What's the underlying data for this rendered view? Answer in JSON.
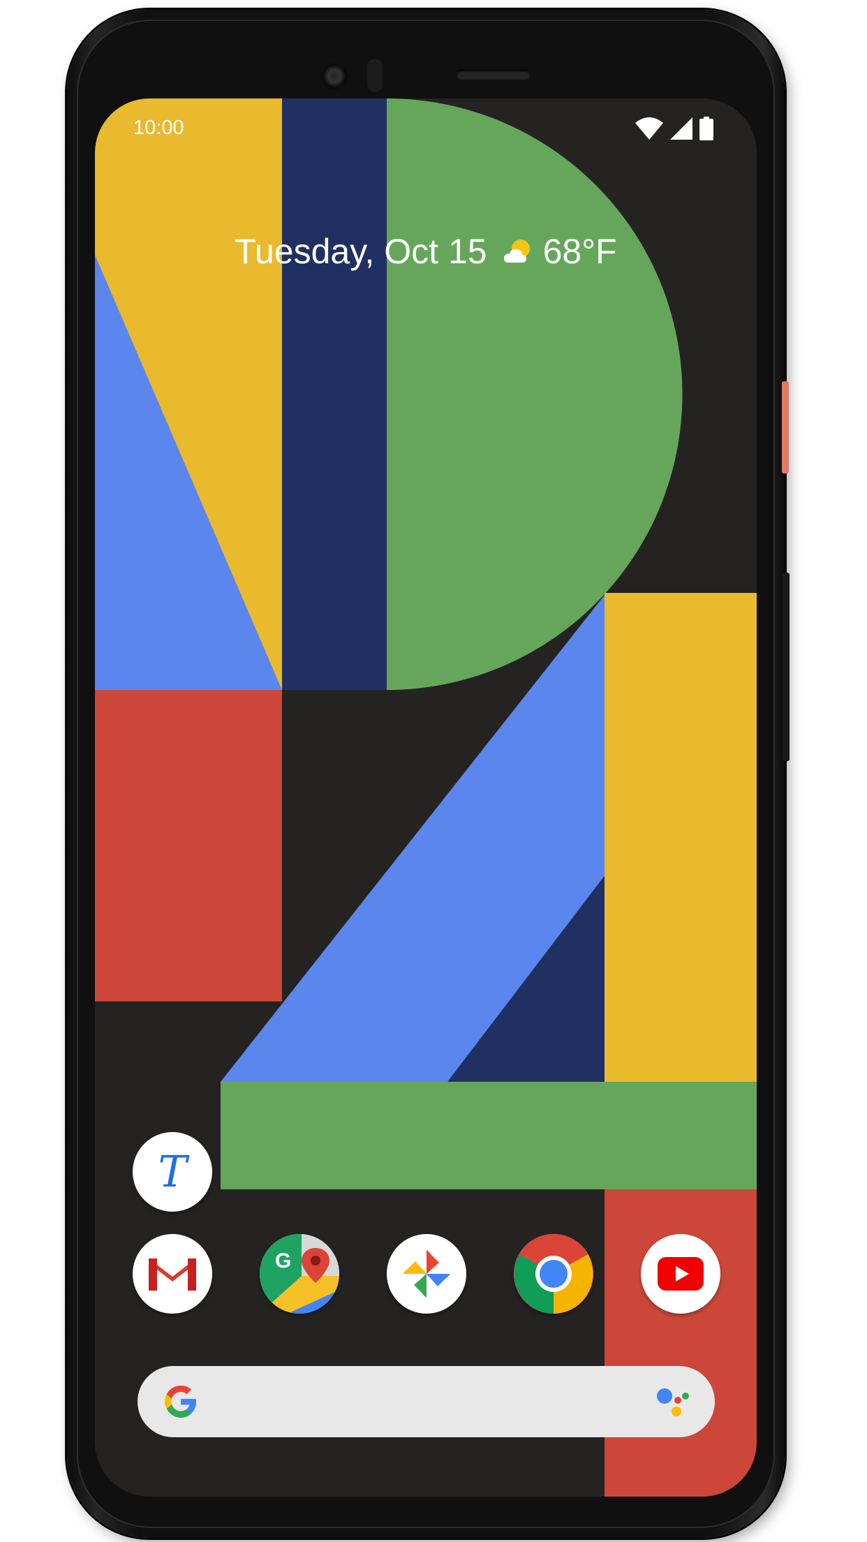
{
  "status_bar": {
    "time": "10:00",
    "icons": [
      "wifi-icon",
      "cell-signal-icon",
      "battery-icon"
    ]
  },
  "at_a_glance": {
    "date": "Tuesday, Oct 15",
    "weather_icon": "partly-sunny-icon",
    "temperature": "68°F"
  },
  "wallpaper_colors": {
    "yellow": "#E9B92E",
    "navy": "#203063",
    "green": "#66A65A",
    "blue": "#5B86EE",
    "red": "#CC473A",
    "background": "#242322"
  },
  "apps": {
    "standalone": [
      {
        "name": "Typewise",
        "icon": "typewise-icon",
        "glyph": "T"
      }
    ],
    "dock": [
      {
        "name": "Gmail",
        "icon": "gmail-icon"
      },
      {
        "name": "Maps",
        "icon": "maps-icon"
      },
      {
        "name": "Photos",
        "icon": "photos-icon"
      },
      {
        "name": "Chrome",
        "icon": "chrome-icon"
      },
      {
        "name": "YouTube",
        "icon": "youtube-icon"
      }
    ]
  },
  "search_bar": {
    "logo": "google-g-icon",
    "assistant": "google-assistant-icon"
  },
  "device": {
    "power_key_color": "#E07A62"
  }
}
